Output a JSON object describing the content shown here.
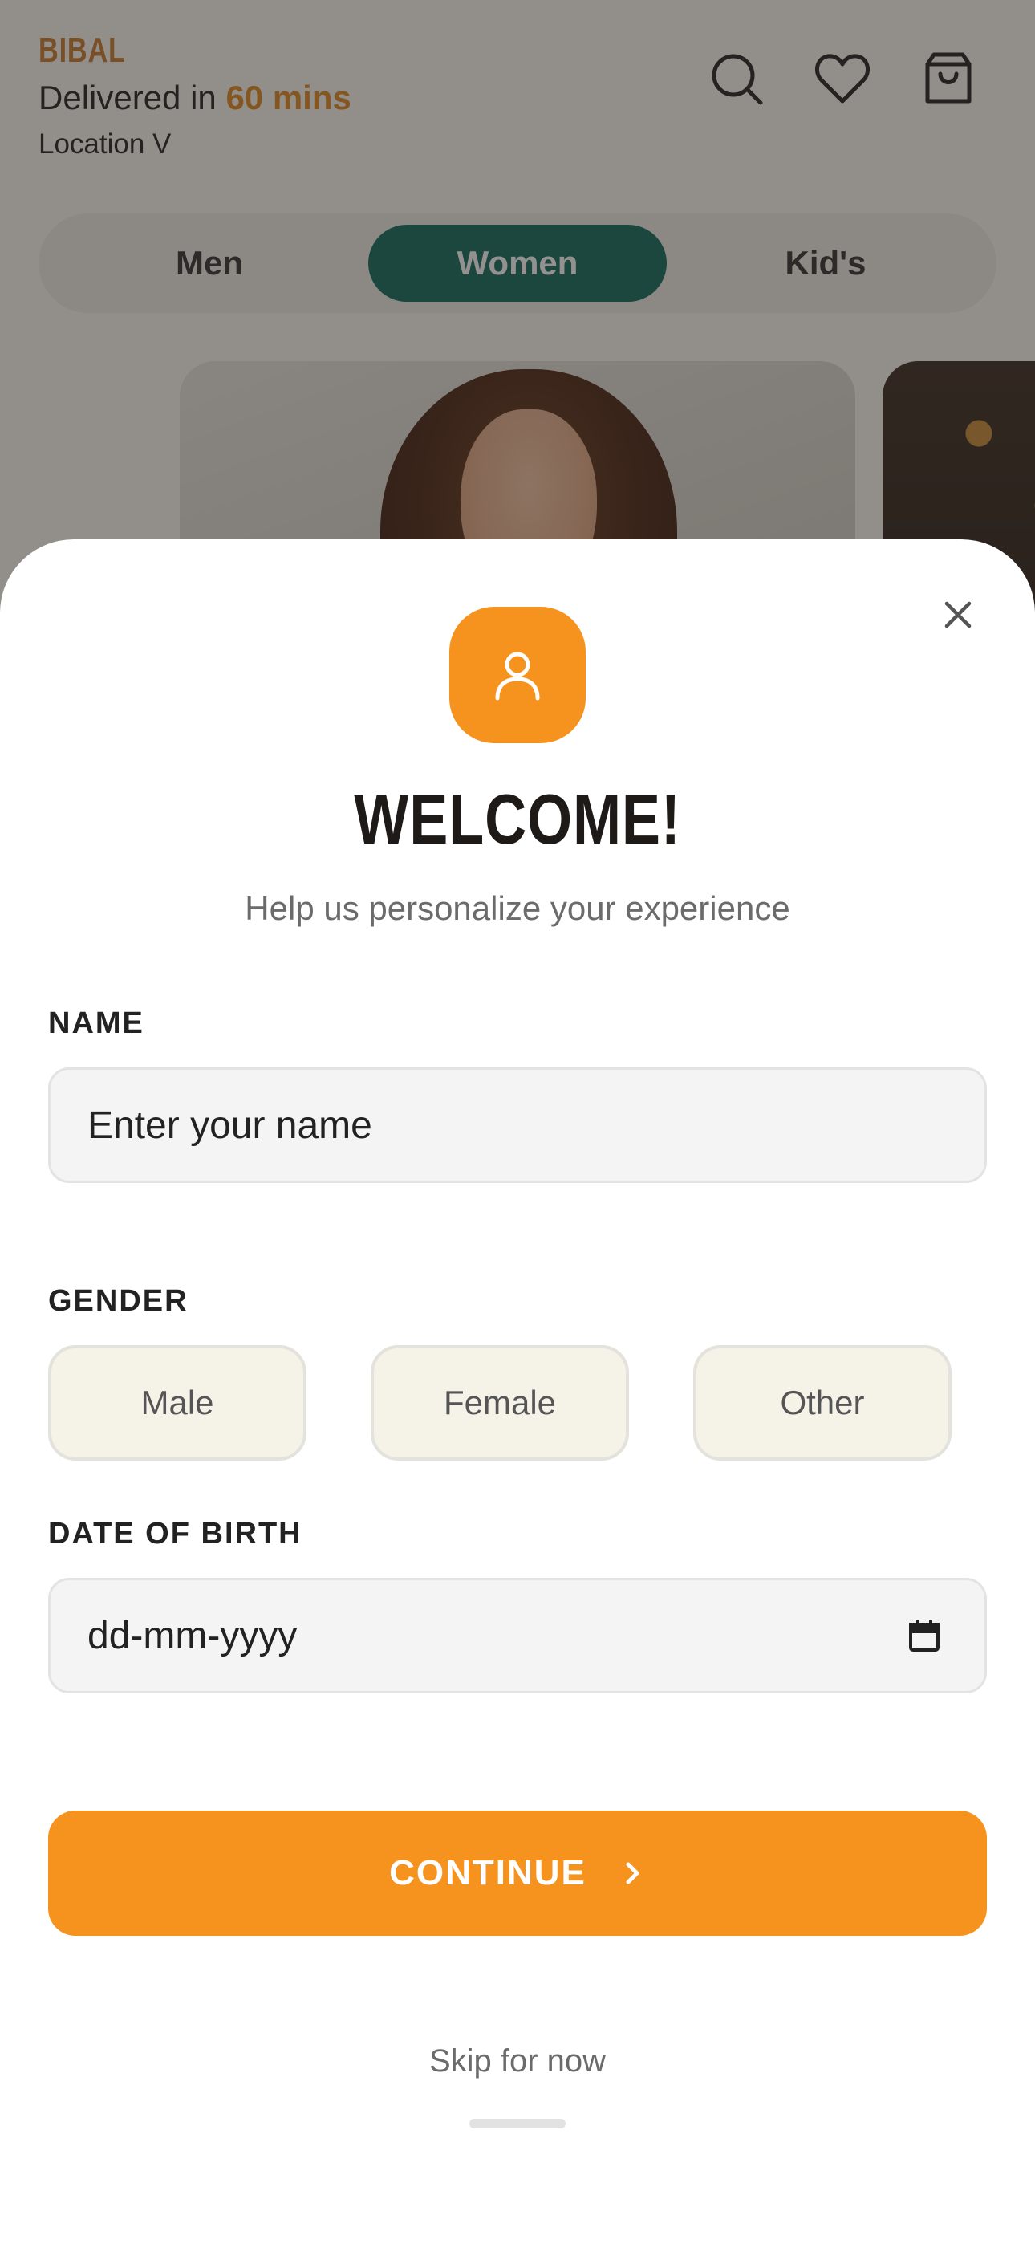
{
  "header": {
    "brand": "BIBAL",
    "delivery_prefix": "Delivered in ",
    "delivery_time": "60 mins",
    "location_label": "Location V",
    "icons": [
      "search-icon",
      "heart-icon",
      "bag-icon"
    ]
  },
  "category_tabs": {
    "items": [
      "Men",
      "Women",
      "Kid's"
    ],
    "selected": "Women"
  },
  "sheet": {
    "title": "WELCOME!",
    "subtitle": "Help us personalize your experience",
    "name_label": "NAME",
    "name_placeholder": "Enter your name",
    "gender_label": "GENDER",
    "gender_options": [
      "Male",
      "Female",
      "Other"
    ],
    "dob_label": "DATE OF BIRTH",
    "dob_placeholder": "dd-mm-yyyy",
    "continue_label": "CONTINUE",
    "skip_label": "Skip for now"
  },
  "colors": {
    "accent": "#f6921e",
    "brand": "#c97a2c",
    "tab_active": "#0f6b5d",
    "gender_bg": "#f5f2e8"
  }
}
